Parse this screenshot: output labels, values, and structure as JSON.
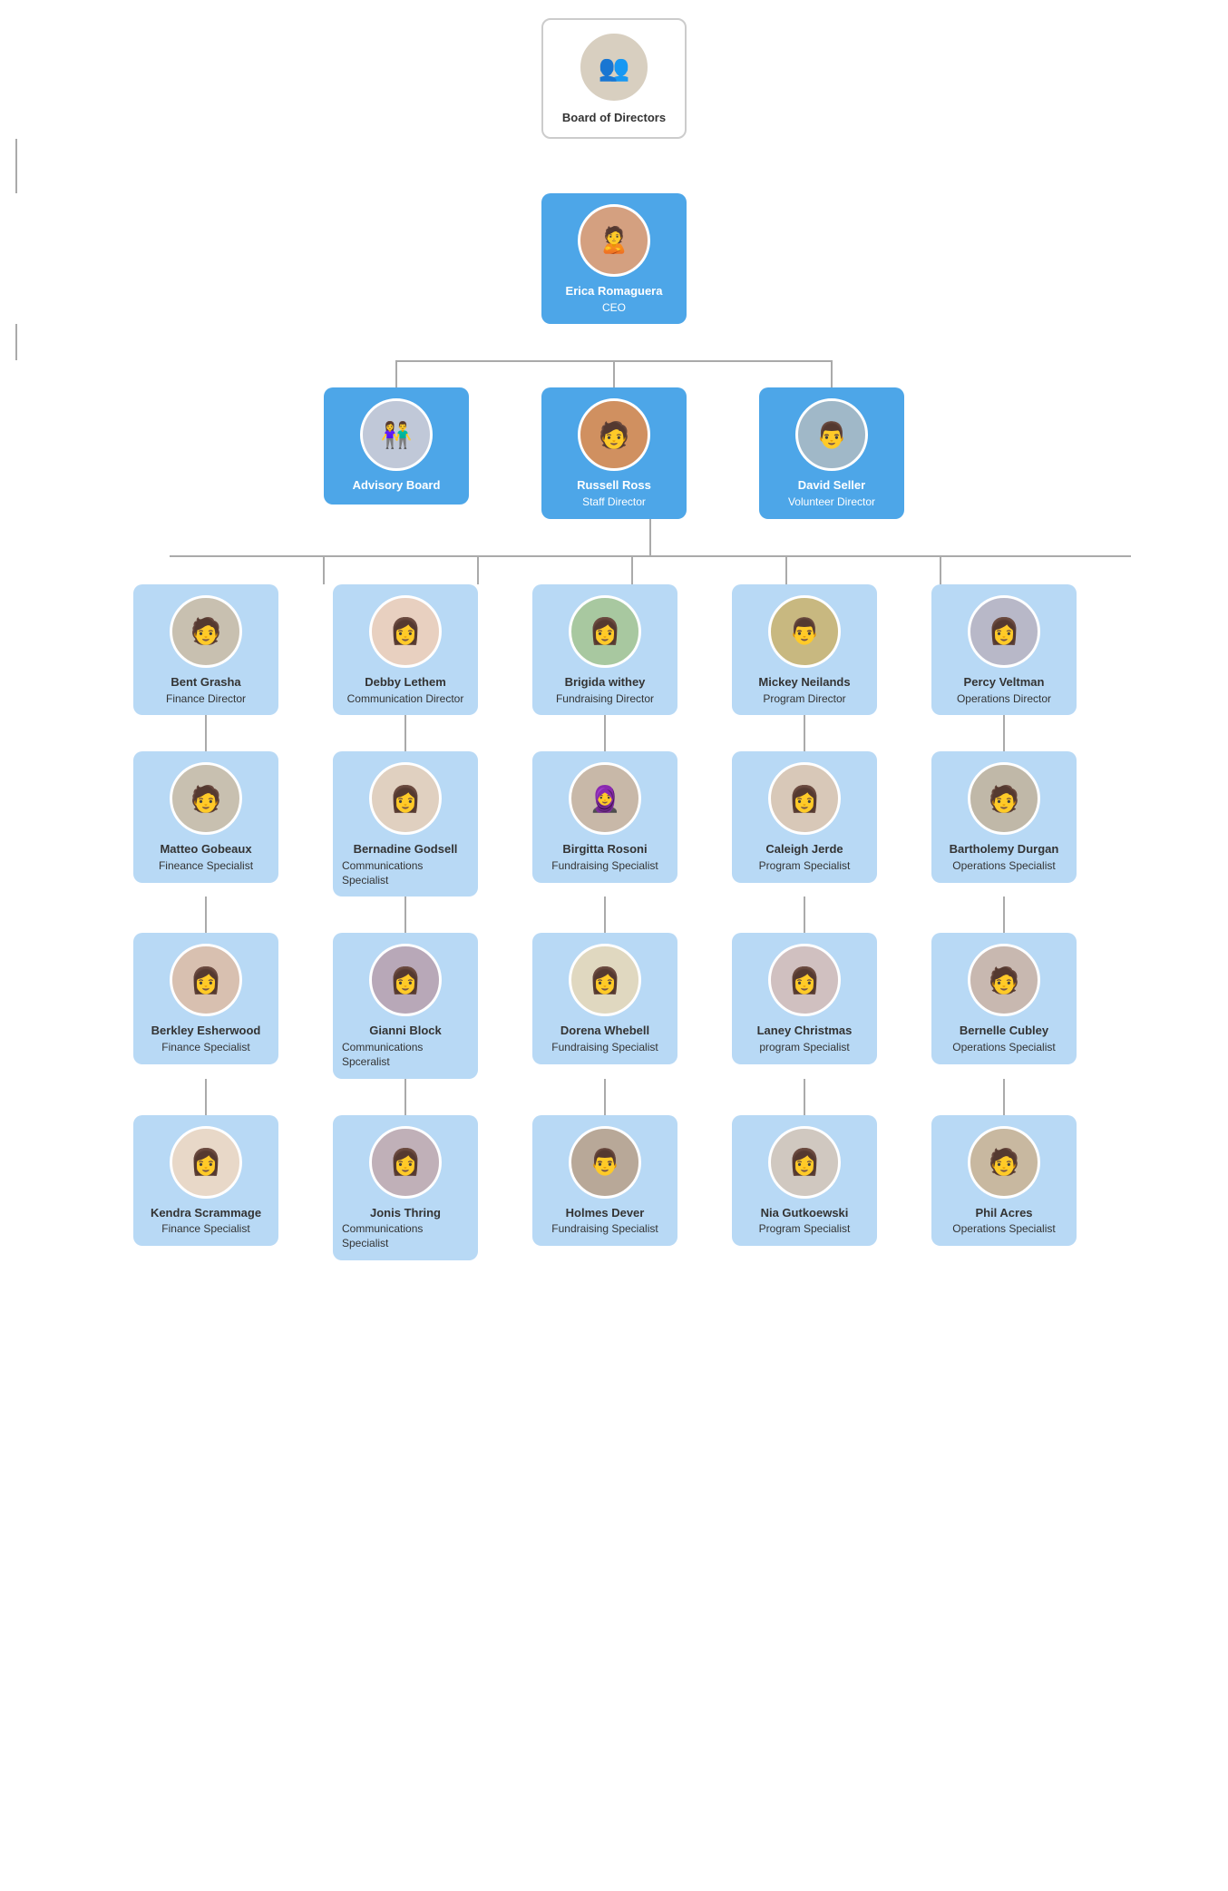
{
  "nodes": {
    "board": {
      "name": "Board of Directors",
      "title": "",
      "avatar_emoji": "👥",
      "avatar_color": "#d8cfc0"
    },
    "ceo": {
      "name": "Erica Romaguera",
      "title": "CEO",
      "avatar_color": "#d4a080"
    },
    "advisory": {
      "name": "Advisory Board",
      "title": "",
      "avatar_color": "#c0c8d8"
    },
    "russell": {
      "name": "Russell Ross",
      "title": "Staff Director",
      "avatar_color": "#d0900060"
    },
    "david": {
      "name": "David Seller",
      "title": "Volunteer Director",
      "avatar_color": "#a0b8c8"
    },
    "bent": {
      "name": "Bent Grasha",
      "title": "Finance Director",
      "avatar_color": "#c8c0b0"
    },
    "debby": {
      "name": "Debby Lethem",
      "title": "Communication Director",
      "avatar_color": "#e8d0c0"
    },
    "brigida": {
      "name": "Brigida withey",
      "title": "Fundraising Director",
      "avatar_color": "#a8c8a0"
    },
    "mickey": {
      "name": "Mickey Neilands",
      "title": "Program Director",
      "avatar_color": "#c8b880"
    },
    "percy": {
      "name": "Percy Veltman",
      "title": "Operations Director",
      "avatar_color": "#b8b8c8"
    },
    "matteo": {
      "name": "Matteo Gobeaux",
      "title": "Fineance Specialist",
      "avatar_color": "#c8c0b0"
    },
    "bernadine": {
      "name": "Bernadine Godsell",
      "title": "Communications Specialist",
      "avatar_color": "#e0d0c0"
    },
    "birgitta": {
      "name": "Birgitta Rosoni",
      "title": "Fundraising Specialist",
      "avatar_color": "#c8b8a8"
    },
    "caleigh": {
      "name": "Caleigh Jerde",
      "title": "Program Specialist",
      "avatar_color": "#d8c8b8"
    },
    "bartholemy": {
      "name": "Bartholemy Durgan",
      "title": "Operations Specialist",
      "avatar_color": "#c0b8a8"
    },
    "berkley": {
      "name": "Berkley Esherwood",
      "title": "Finance Specialist",
      "avatar_color": "#d8c0b0"
    },
    "gianni": {
      "name": "Gianni Block",
      "title": "Communications Spceralist",
      "avatar_color": "#b8a8b8"
    },
    "dorena": {
      "name": "Dorena Whebell",
      "title": "Fundraising Specialist",
      "avatar_color": "#e0d8c0"
    },
    "laney": {
      "name": "Laney Christmas",
      "title": "program Specialist",
      "avatar_color": "#d0c0c0"
    },
    "bernelle": {
      "name": "Bernelle Cubley",
      "title": "Operations Specialist",
      "avatar_color": "#c8b8b0"
    },
    "kendra": {
      "name": "Kendra Scrammage",
      "title": "Finance Specialist",
      "avatar_color": "#e8d8c8"
    },
    "jonis": {
      "name": "Jonis Thring",
      "title": "Communications Specialist",
      "avatar_color": "#c0b0b8"
    },
    "holmes": {
      "name": "Holmes Dever",
      "title": "Fundraising Specialist",
      "avatar_color": "#b8a898"
    },
    "nia": {
      "name": "Nia Gutkoewski",
      "title": "Program Specialist",
      "avatar_color": "#d0c8c0"
    },
    "phil": {
      "name": "Phil Acres",
      "title": "Operations Specialist",
      "avatar_color": "#c8b8a0"
    }
  },
  "colors": {
    "blue": "#4da6e8",
    "light_blue": "#b8d9f5",
    "white_border": "#cccccc",
    "line": "#aaaaaa"
  }
}
